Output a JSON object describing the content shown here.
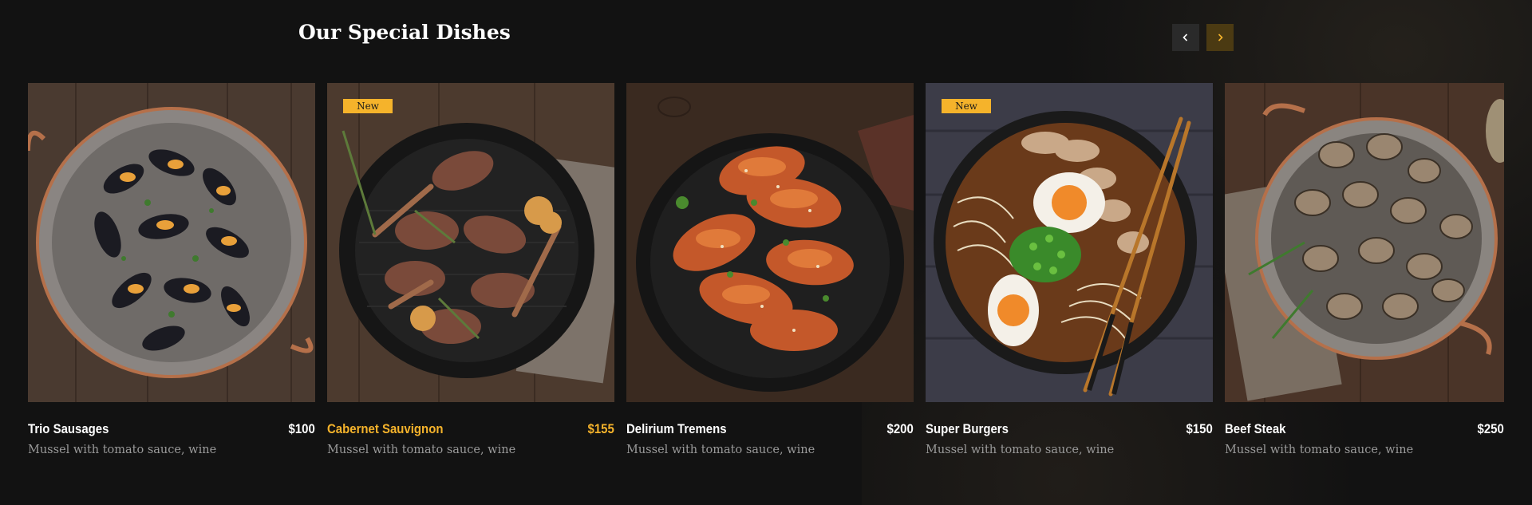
{
  "section": {
    "title": "Our Special Dishes"
  },
  "nav": {
    "prev_icon": "chevron-left-icon",
    "next_icon": "chevron-right-icon"
  },
  "colors": {
    "accent": "#f5b32b",
    "background": "#121212",
    "text": "#ffffff",
    "muted": "#9a9a9a"
  },
  "dishes": [
    {
      "name": "Trio Sausages",
      "price": "$100",
      "description": "Mussel with tomato sauce, wine",
      "badge": "",
      "image": "mussels-pan"
    },
    {
      "name": "Cabernet Sauvignon",
      "price": "$155",
      "description": "Mussel with tomato sauce, wine",
      "badge": "New",
      "image": "grilled-lamb-chops"
    },
    {
      "name": "Delirium Tremens",
      "price": "$200",
      "description": "Mussel with tomato sauce, wine",
      "badge": "",
      "image": "glazed-chicken-drumsticks"
    },
    {
      "name": "Super Burgers",
      "price": "$150",
      "description": "Mussel with tomato sauce, wine",
      "badge": "New",
      "image": "ramen-bowl"
    },
    {
      "name": "Beef Steak",
      "price": "$250",
      "description": "Mussel with tomato sauce, wine",
      "badge": "",
      "image": "clams-pan"
    }
  ]
}
